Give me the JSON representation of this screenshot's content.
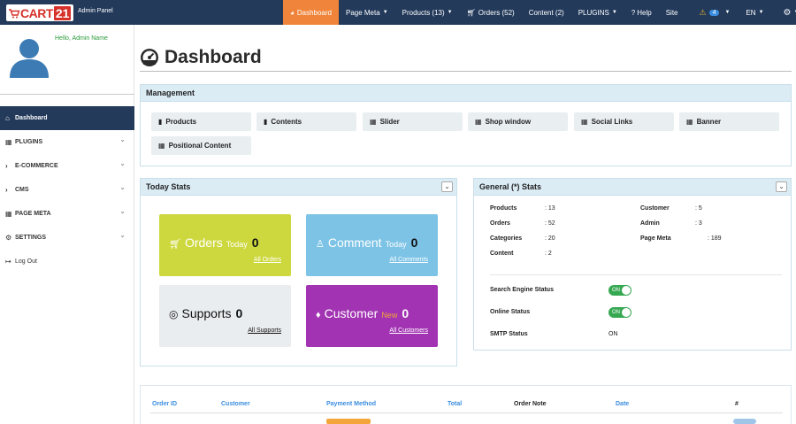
{
  "brand": {
    "logo_text": "CART",
    "logo_num": "21",
    "subtitle": "Admin Panel"
  },
  "nav": {
    "items": [
      {
        "label": "Dashboard",
        "icon": "dashboard-icon",
        "active": true
      },
      {
        "label": "Page Meta",
        "caret": true
      },
      {
        "label": "Products (13)",
        "caret": true
      },
      {
        "label": "Orders (52)",
        "icon": "cart-icon"
      },
      {
        "label": "Content (2)"
      },
      {
        "label": "PLUGINS",
        "caret": true
      },
      {
        "label": "Help",
        "icon": "help-icon"
      },
      {
        "label": "Site"
      }
    ],
    "alerts_count": "4",
    "language": "EN"
  },
  "sidebar": {
    "greeting": "Hello, Admin Name",
    "items": [
      {
        "label": "Dashboard",
        "icon": "dashboard-icon",
        "active": true
      },
      {
        "label": "PLUGINS",
        "icon": "table-icon",
        "chevron": true
      },
      {
        "label": "E-COMMERCE",
        "icon": "chevron-right-icon",
        "chevron": true
      },
      {
        "label": "CMS",
        "icon": "chevron-right-icon",
        "chevron": true
      },
      {
        "label": "PAGE META",
        "icon": "table-icon",
        "chevron": true
      },
      {
        "label": "SETTINGS",
        "icon": "gear-icon",
        "chevron": true
      },
      {
        "label": "Log Out",
        "icon": "logout-icon"
      }
    ]
  },
  "page": {
    "title": "Dashboard"
  },
  "management": {
    "title": "Management",
    "buttons": [
      {
        "label": "Products",
        "icon": "file-icon"
      },
      {
        "label": "Contents",
        "icon": "file-icon"
      },
      {
        "label": "Slider",
        "icon": "table-icon"
      },
      {
        "label": "Shop window",
        "icon": "table-icon"
      },
      {
        "label": "Social Links",
        "icon": "table-icon"
      },
      {
        "label": "Banner",
        "icon": "table-icon"
      },
      {
        "label": "Positional Content",
        "icon": "table-icon"
      }
    ]
  },
  "today_stats": {
    "title": "Today Stats",
    "cards": [
      {
        "title": "Orders",
        "tag": "Today",
        "count": "0",
        "link": "All Orders",
        "color": "#cdd83e"
      },
      {
        "title": "Comment",
        "tag": "Today",
        "count": "0",
        "link": "All Comments",
        "color": "#7cc3e6"
      },
      {
        "title": "Supports",
        "tag": "",
        "count": "0",
        "link": "All Supports",
        "color": "#eaedf0"
      },
      {
        "title": "Customer",
        "tag": "New",
        "count": "0",
        "link": "All Customers",
        "color": "#a234b3"
      }
    ]
  },
  "general_stats": {
    "title": "General (*) Stats",
    "left": [
      {
        "label": "Products",
        "value": ": 13"
      },
      {
        "label": "Orders",
        "value": ": 52"
      },
      {
        "label": "Categories",
        "value": ": 20"
      },
      {
        "label": "Content",
        "value": ": 2"
      }
    ],
    "right": [
      {
        "label": "Customer",
        "value": ": 5"
      },
      {
        "label": "Admin",
        "value": ": 3"
      },
      {
        "label": "Page Meta",
        "value": ": 189"
      }
    ],
    "statuses": [
      {
        "label": "Search Engine Status",
        "value": "ON"
      },
      {
        "label": "Online Status",
        "value": "ON"
      },
      {
        "label": "SMTP Status",
        "value": "ON"
      }
    ]
  },
  "orders_table": {
    "headers": [
      "Order ID",
      "Customer",
      "Payment Method",
      "Total",
      "Order Note",
      "Date",
      "#"
    ]
  }
}
